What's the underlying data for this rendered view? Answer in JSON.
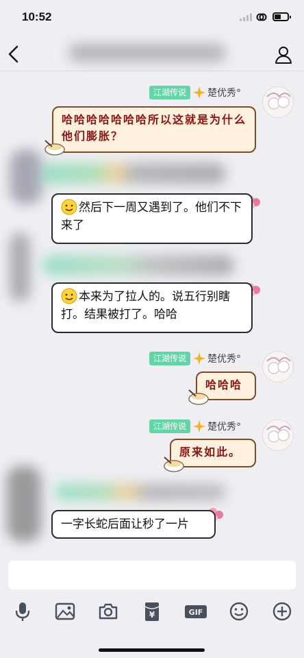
{
  "status": {
    "time": "10:52"
  },
  "nav": {
    "back_icon": "chevron-left-icon",
    "profile_icon": "contact-icon"
  },
  "sender": {
    "badge": "江湖传说",
    "name": "楚优秀°"
  },
  "messages": [
    {
      "text": "哈哈哈哈哈哈哈所以这就是为什么他们膨胀？"
    },
    {
      "emoji": "smile-emoji",
      "text": "然后下一周又遇到了。他们不下来了"
    },
    {
      "emoji": "smile-emoji",
      "text": "本来为了拉人的。说五行别瞎打。结果被打了。哈哈"
    },
    {
      "text": "哈哈哈"
    },
    {
      "text": "原来如此。"
    },
    {
      "text": "一字长蛇后面让秒了一片"
    }
  ],
  "toolbar": [
    "microphone-icon",
    "image-icon",
    "camera-icon",
    "red-packet-icon",
    "gif-icon",
    "emoji-icon",
    "plus-icon"
  ],
  "colors": {
    "badge": "#62d6a6",
    "cute_bubble_bg": "#fdf0dc",
    "cute_text": "#8a1414",
    "background": "#eeeef3"
  }
}
